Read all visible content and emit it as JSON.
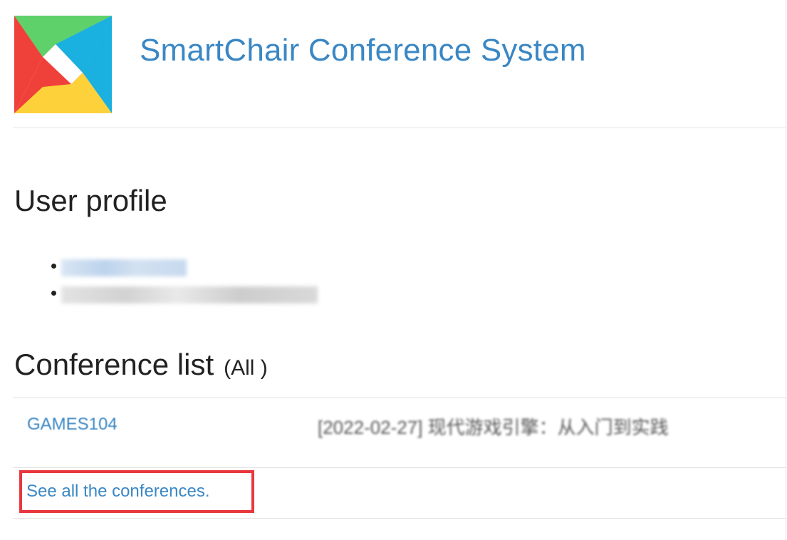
{
  "header": {
    "site_title": "SmartChair Conference System"
  },
  "profile": {
    "heading": "User profile",
    "items": [
      "",
      ""
    ]
  },
  "conferences": {
    "heading": "Conference list",
    "filter_label": "(All )",
    "rows": [
      {
        "id": "GAMES104",
        "title": "[2022-02-27] 现代游戏引擎：从入门到实践"
      }
    ],
    "see_all_link": "See all the conferences."
  },
  "colors": {
    "link": "#3a87c4",
    "highlight_box": "#e8383d",
    "logo_green": "#5fd16a",
    "logo_blue": "#1ab0df",
    "logo_red": "#f0403a",
    "logo_yellow": "#fdd13a"
  }
}
